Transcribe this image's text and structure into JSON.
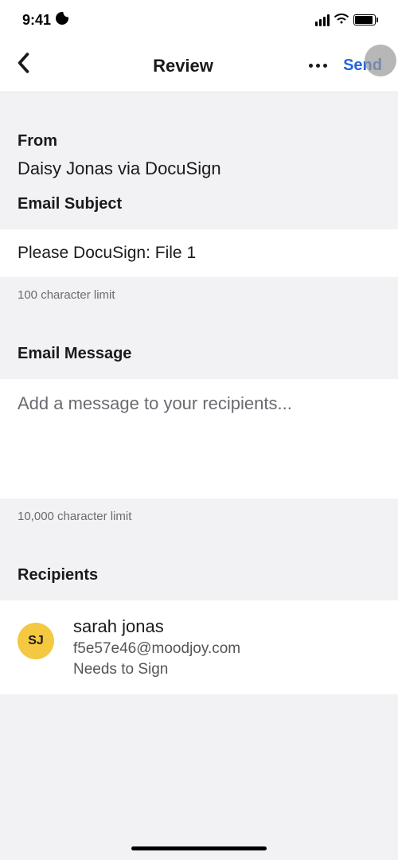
{
  "statusBar": {
    "time": "9:41"
  },
  "nav": {
    "title": "Review",
    "send": "Send"
  },
  "from": {
    "label": "From",
    "value": "Daisy Jonas via DocuSign"
  },
  "subject": {
    "label": "Email Subject",
    "value": "Please DocuSign: File 1",
    "limit": "100 character limit"
  },
  "message": {
    "label": "Email Message",
    "placeholder": "Add a message to your recipients...",
    "limit": "10,000 character limit"
  },
  "recipients": {
    "label": "Recipients",
    "items": [
      {
        "initials": "SJ",
        "name": "sarah jonas",
        "email": "f5e57e46@moodjoy.com",
        "status": "Needs to Sign"
      }
    ]
  }
}
